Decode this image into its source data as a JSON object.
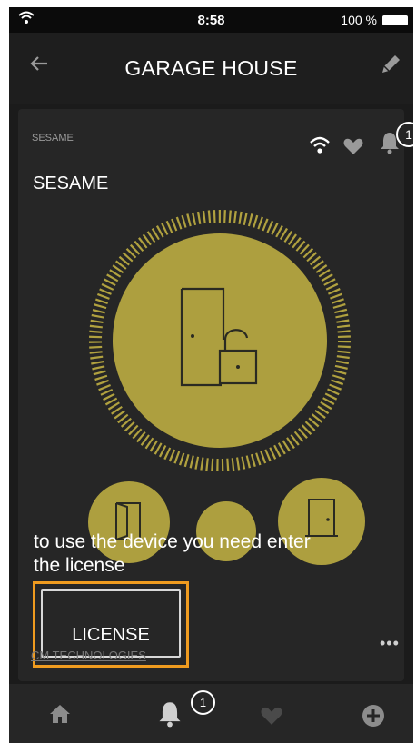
{
  "status_bar": {
    "time": "8:58",
    "battery": "100 %"
  },
  "header": {
    "title": "GARAGE HOUSE"
  },
  "device_card": {
    "small_label": "SESAME",
    "device_name": "SESAME",
    "notification_count": "1",
    "message": "to use the device you need enter the license",
    "license_button": "LICENSE",
    "company": "CM TECHNOLOGIES",
    "more": "•••"
  },
  "tab_bar": {
    "notification_count": "1"
  },
  "colors": {
    "accent": "#ad9f3f",
    "highlight": "#ef9b1f",
    "background": "#1b1b1b"
  }
}
